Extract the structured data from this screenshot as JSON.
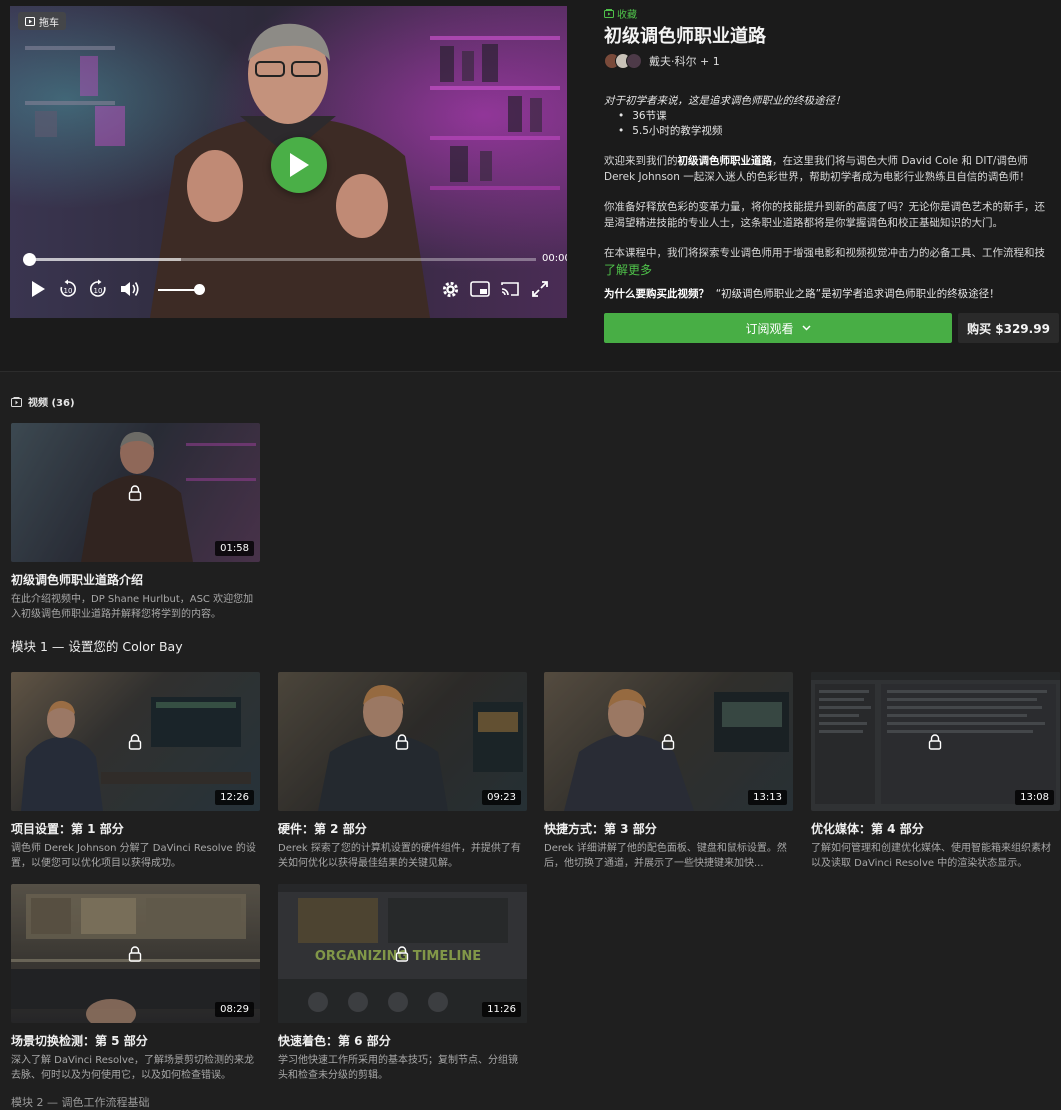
{
  "player": {
    "badge": "拖车",
    "time": "00:00",
    "progress_buffered": 0.3
  },
  "course": {
    "collect_label": "收藏",
    "title": "初级调色师职业道路",
    "instructors": "戴夫·科尔 + 1",
    "tagline": "对于初学者来说，这是追求调色师职业的终极途径！",
    "bullets": [
      "36节课",
      "5.5小时的教学视频"
    ],
    "para1_prefix": "欢迎来到我们的",
    "para1_bold": "初级调色师职业道路",
    "para1_suffix": "，在这里我们将与调色大师 David Cole 和 DIT/调色师 Derek Johnson 一起深入迷人的色彩世界，帮助初学者成为电影行业熟练且自信的调色师！",
    "para2": "你准备好释放色彩的变革力量，将你的技能提升到新的高度了吗？无论你是调色艺术的新手，还是渴望精进技能的专业人士，这条职业道路都将是你掌握调色和校正基础知识的大门。",
    "para3": "在本课程中，我们将探索专业调色师用于增强电影和视频视觉冲击力的必备工具、工作流程和技",
    "learn_more": "了解更多",
    "why_label": "为什么要购买此视频？",
    "why_text": "“初级调色师职业之路”是初学者追求调色师职业的终极途径！",
    "subscribe_label": "订阅观看",
    "buy_label": "购买 $329.99"
  },
  "videos_header": "视频 (36)",
  "intro": {
    "title": "初级调色师职业道路介绍",
    "desc": "在此介绍视频中，DP Shane Hurlbut，ASC 欢迎您加入初级调色师职业道路并解释您将学到的内容。",
    "duration": "01:58"
  },
  "module1": {
    "heading": "模块 1 — 设置您的 Color Bay",
    "lessons": [
      {
        "title": "项目设置：第 1 部分",
        "desc": "调色师 Derek Johnson 分解了 DaVinci Resolve 的设置，以便您可以优化项目以获得成功。",
        "duration": "12:26"
      },
      {
        "title": "硬件：第 2 部分",
        "desc": "Derek 探索了您的计算机设置的硬件组件，并提供了有关如何优化以获得最佳结果的关键见解。",
        "duration": "09:23"
      },
      {
        "title": "快捷方式：第 3 部分",
        "desc": "Derek 详细讲解了他的配色面板、键盘和鼠标设置。然后，他切换了通道，并展示了一些快捷键来加快...",
        "duration": "13:13"
      },
      {
        "title": "优化媒体：第 4 部分",
        "desc": "了解如何管理和创建优化媒体、使用智能箱来组织素材以及读取 DaVinci Resolve 中的渲染状态显示。",
        "duration": "13:08"
      },
      {
        "title": "场景切换检测：第 5 部分",
        "desc": "深入了解 DaVinci Resolve，了解场景剪切检测的来龙去脉、何时以及为何使用它，以及如何检查错误。",
        "duration": "08:29"
      },
      {
        "title": "快速着色：第 6 部分",
        "desc": "学习他快速工作所采用的基本技巧；复制节点、分组镜头和检查未分级的剪辑。",
        "duration": "11:26"
      }
    ],
    "overlay_text": "ORGANIZING TIMELINE"
  },
  "next_module": "模块 2 — 调色工作流程基础"
}
